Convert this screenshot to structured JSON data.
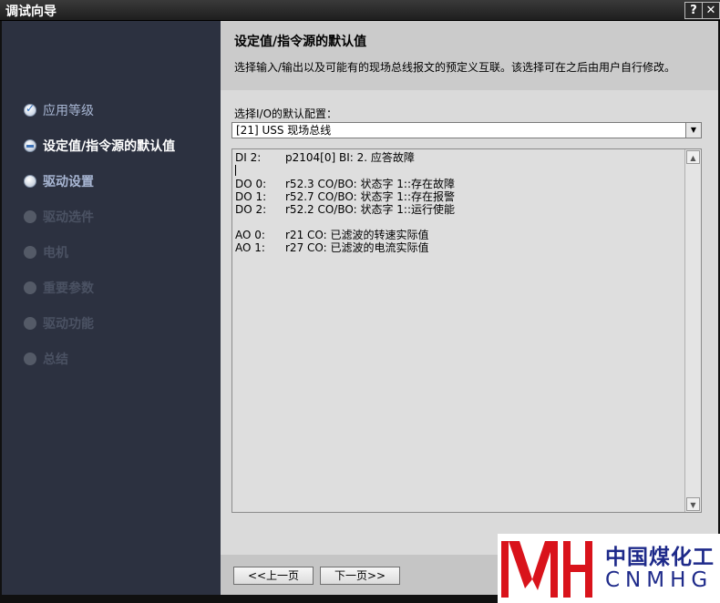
{
  "window": {
    "title": "调试向导",
    "help_label": "?",
    "close_label": "✕"
  },
  "sidebar": {
    "items": [
      {
        "label": "应用等级",
        "state": "done"
      },
      {
        "label": "设定值/指令源的默认值",
        "state": "current"
      },
      {
        "label": "驱动设置",
        "state": "next"
      },
      {
        "label": "驱动选件",
        "state": "disabled"
      },
      {
        "label": "电机",
        "state": "disabled"
      },
      {
        "label": "重要参数",
        "state": "disabled"
      },
      {
        "label": "驱动功能",
        "state": "disabled"
      },
      {
        "label": "总结",
        "state": "disabled"
      }
    ]
  },
  "header": {
    "title": "设定值/指令源的默认值",
    "description": "选择输入/输出以及可能有的现场总线报文的预定义互联。该选择可在之后由用户自行修改。"
  },
  "config": {
    "label": "选择I/O的默认配置：",
    "selected": "[21] USS 现场总线"
  },
  "io_list": {
    "di": [
      {
        "k": "DI 2:",
        "v": "p2104[0] BI: 2. 应答故障"
      }
    ],
    "do": [
      {
        "k": "DO 0:",
        "v": "r52.3 CO/BO: 状态字 1::存在故障"
      },
      {
        "k": "DO 1:",
        "v": "r52.7 CO/BO: 状态字 1::存在报警"
      },
      {
        "k": "DO 2:",
        "v": "r52.2 CO/BO: 状态字 1::运行使能"
      }
    ],
    "ao": [
      {
        "k": "AO 0:",
        "v": "r21 CO: 已滤波的转速实际值"
      },
      {
        "k": "AO 1:",
        "v": "r27 CO: 已滤波的电流实际值"
      }
    ]
  },
  "footer": {
    "prev_label": "<<上一页",
    "next_label": "下一页>>"
  },
  "logo": {
    "cn_text": "中国煤化工",
    "en_text": "CNMHG"
  },
  "colors": {
    "sidebar_bg": "#2c3140",
    "logo_red": "#d9131b",
    "logo_blue": "#1e2a8a"
  }
}
